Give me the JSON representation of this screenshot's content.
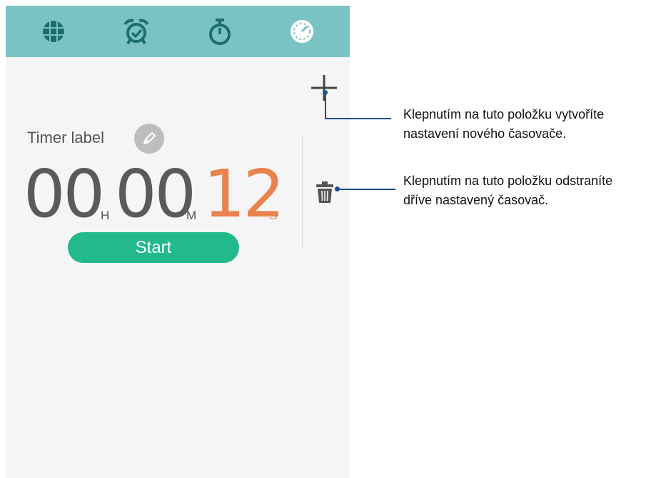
{
  "tabs": [
    {
      "icon": "globe-icon"
    },
    {
      "icon": "alarm-clock-icon"
    },
    {
      "icon": "stopwatch-icon"
    },
    {
      "icon": "timer-icon",
      "selected": true
    }
  ],
  "timer": {
    "label": "Timer label",
    "hours": "00",
    "hours_unit": "H",
    "minutes": "00",
    "minutes_unit": "M",
    "seconds": "12",
    "seconds_unit": "S",
    "start_label": "Start"
  },
  "callouts": {
    "add_line1": "Klepnutím na tuto položku vytvoříte",
    "add_line2": "nastavení nového časovače.",
    "delete_line1": "Klepnutím na tuto položku odstraníte",
    "delete_line2": "dříve nastavený časovač."
  },
  "colors": {
    "tab_bar": "#7bc2c2",
    "tab_icon": "#1b6e6e",
    "seconds": "#e8834e",
    "start_button": "#22b98b",
    "callout_line": "#1f4e93"
  }
}
